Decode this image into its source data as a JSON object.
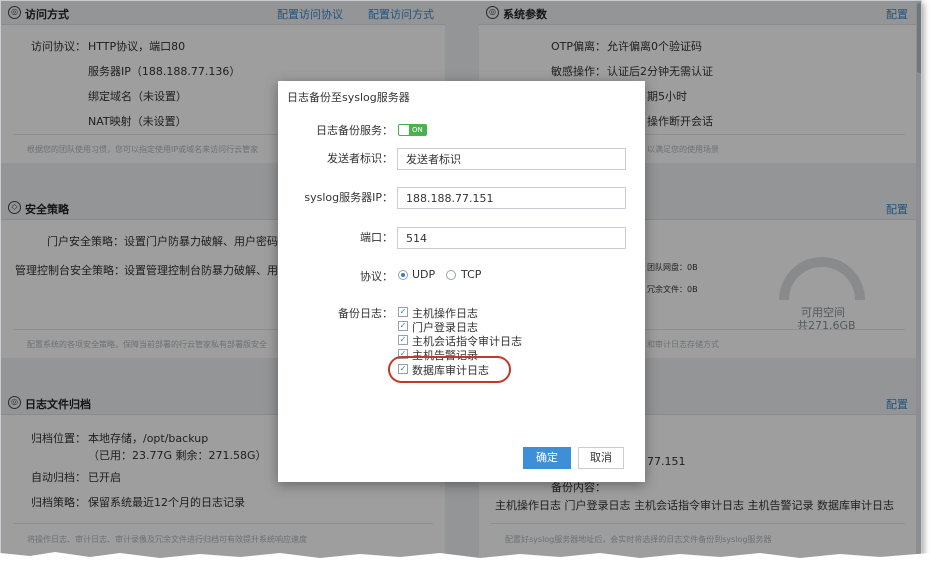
{
  "access": {
    "title": "访问方式",
    "links": [
      "配置访问协议",
      "配置访问方式"
    ],
    "rows": [
      {
        "label": "访问协议：",
        "value": "HTTP协议，端口80"
      },
      {
        "label": "",
        "value": "服务器IP（188.188.77.136）"
      },
      {
        "label": "",
        "value": "绑定域名（未设置）"
      },
      {
        "label": "",
        "value": "NAT映射（未设置）"
      }
    ],
    "hint": "根据您的团队使用习惯，您可以指定使用IP或域名来访问行云管家"
  },
  "sys": {
    "title": "系统参数",
    "link": "配置",
    "rows": [
      {
        "label": "OTP偏离：",
        "value": "允许偏离0个验证码"
      },
      {
        "label": "敏感操作：",
        "value": "认证后2分钟无需认证"
      },
      {
        "label": "",
        "value": "期5小时"
      },
      {
        "label": "",
        "value": "操作断开会话"
      }
    ],
    "hint": "以满足您的使用场景"
  },
  "security": {
    "title": "安全策略",
    "link": "配置",
    "rows": [
      {
        "label": "门户安全策略：",
        "value": "设置门户防暴力破解、用户密码强度"
      },
      {
        "label": "管理控制台安全策略：",
        "value": "设置管理控制台防暴力破解、用户"
      }
    ],
    "hint": "配置系统的各项安全策略，保障当前部署的行云管家私有部署版安全"
  },
  "storage": {
    "items": [
      "团队网盘：0B",
      "冗余文件：0B"
    ],
    "free_label": "可用空间",
    "free_value": "共271.6GB",
    "hint": "和审计日志存储方式",
    "free_fraction": 1.0
  },
  "archive": {
    "title": "日志文件归档",
    "link": "配置",
    "rows": [
      {
        "label": "归档位置：",
        "value": "本地存储，/opt/backup"
      },
      {
        "label": "",
        "value": "（已用：23.77G 剩余：271.58G）"
      },
      {
        "label": "自动归档：",
        "value": "已开启"
      },
      {
        "label": "归档策略：",
        "value": "保留系统最近12个月的日志记录"
      }
    ],
    "hint": "将操作日志、审计日志、审计录像及冗余文件进行归档可有效提升系统响应速度"
  },
  "syslog": {
    "link": "配置",
    "ip_partial": "77.151",
    "content_label": "备份内容：",
    "content_value": "主机操作日志 门户登录日志 主机会话指令审计日志 主机告警记录 数据库审计日志",
    "hint": "配置好syslog服务器地址后，会实时将选择的日志文件备份到syslog服务器"
  },
  "modal": {
    "title": "日志备份至syslog服务器",
    "service_label": "日志备份服务：",
    "toggle_text": "ON",
    "sender_label": "发送者标识：",
    "sender_value": "发送者标识",
    "ip_label": "syslog服务器IP：",
    "ip_value": "188.188.77.151",
    "port_label": "端口：",
    "port_value": "514",
    "protocol_label": "协议：",
    "protocol_options": [
      "UDP",
      "TCP"
    ],
    "protocol_selected": "UDP",
    "logs_label": "备份日志：",
    "logs": [
      {
        "label": "主机操作日志",
        "checked": true
      },
      {
        "label": "门户登录日志",
        "checked": true
      },
      {
        "label": "主机会话指令审计日志",
        "checked": true
      },
      {
        "label": "主机告警记录",
        "checked": true
      },
      {
        "label": "数据库审计日志",
        "checked": true
      }
    ],
    "ok": "确定",
    "cancel": "取消"
  },
  "colors": {
    "accent": "#3d8fd8",
    "toggle_on": "#4caf50",
    "highlight": "#c0392b"
  }
}
